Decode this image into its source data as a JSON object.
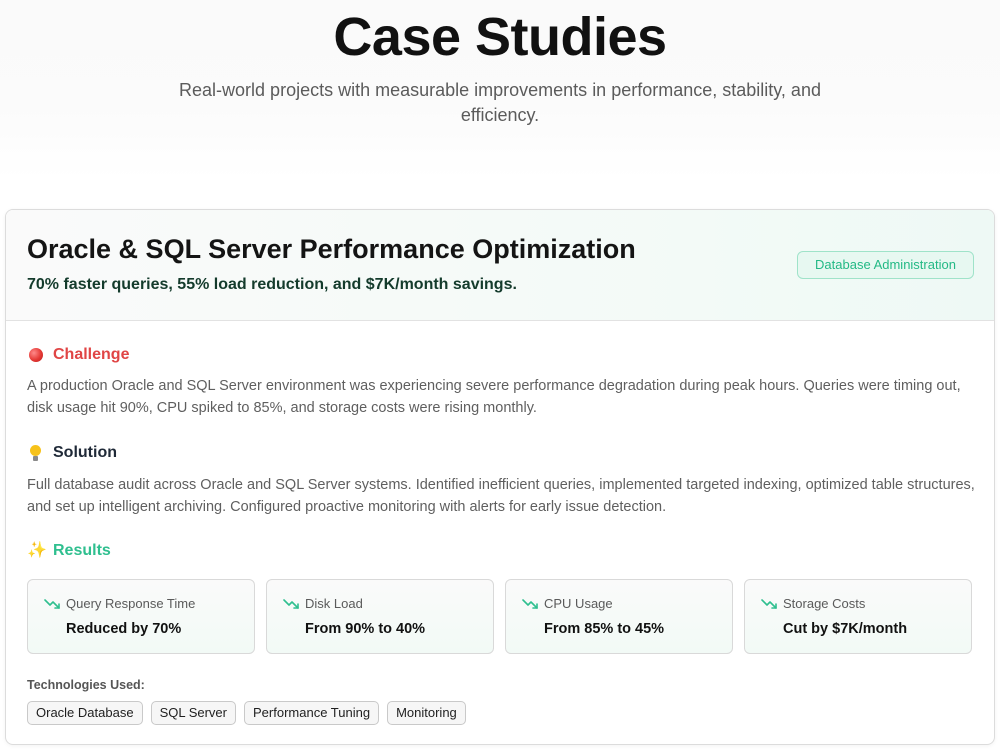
{
  "header": {
    "title": "Case Studies",
    "subtitle": "Real-world projects with measurable improvements in performance, stability, and efficiency."
  },
  "case_study": {
    "title": "Oracle & SQL Server Performance Optimization",
    "summary": "70% faster queries, 55% load reduction, and $7K/month savings.",
    "category": "Database Administration",
    "challenge": {
      "icon": "red-circle-icon",
      "heading": "Challenge",
      "text": "A production Oracle and SQL Server environment was experiencing severe performance degradation during peak hours. Queries were timing out, disk usage hit 90%, CPU spiked to 85%, and storage costs were rising monthly."
    },
    "solution": {
      "icon": "lightbulb-icon",
      "heading": "Solution",
      "text": "Full database audit across Oracle and SQL Server systems. Identified inefficient queries, implemented targeted indexing, optimized table structures, and set up intelligent archiving. Configured proactive monitoring with alerts for early issue detection."
    },
    "results": {
      "icon": "sparkles-icon",
      "heading": "Results",
      "metrics": [
        {
          "label": "Query Response Time",
          "value": "Reduced by 70%",
          "icon": "trending-down-icon"
        },
        {
          "label": "Disk Load",
          "value": "From 90% to 40%",
          "icon": "trending-down-icon"
        },
        {
          "label": "CPU Usage",
          "value": "From 85% to 45%",
          "icon": "trending-down-icon"
        },
        {
          "label": "Storage Costs",
          "value": "Cut by $7K/month",
          "icon": "trending-down-icon"
        }
      ]
    },
    "technologies": {
      "label": "Technologies Used:",
      "items": [
        "Oracle Database",
        "SQL Server",
        "Performance Tuning",
        "Monitoring"
      ]
    }
  },
  "colors": {
    "accent": "#2fbf8f",
    "challenge": "#e04545",
    "badge_text": "#23b985",
    "badge_bg": "#e7f8f1"
  }
}
